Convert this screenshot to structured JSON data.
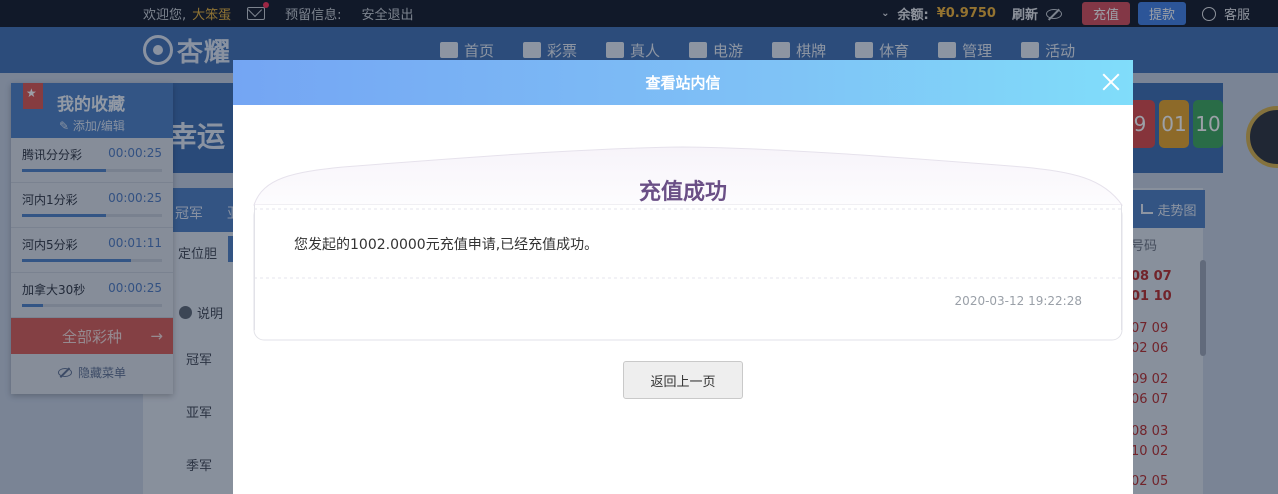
{
  "topbar": {
    "welcome": "欢迎您,",
    "username": "大笨蛋",
    "presale": "预留信息:",
    "logout": "安全退出",
    "balance_label": "余额:",
    "balance_value": "¥0.9750",
    "refresh": "刷新",
    "recharge": "充值",
    "withdraw": "提款",
    "service": "客服"
  },
  "nav": {
    "logo": "杏耀",
    "items": [
      "首页",
      "彩票",
      "真人",
      "电游",
      "棋牌",
      "体育",
      "管理",
      "活动"
    ]
  },
  "background": {
    "banner_text": "幸运",
    "balls": [
      "9",
      "01",
      "10"
    ],
    "tabs": [
      "冠军",
      "亚"
    ],
    "sub_label": "定位胆",
    "explain": "说明",
    "ranks": [
      "冠军",
      "亚军",
      "季军"
    ],
    "trend": "走势图",
    "haoma": "号码",
    "numbers": [
      [
        "08 07",
        "01 10"
      ],
      [
        "07 09",
        "02 06"
      ],
      [
        "09 02",
        "06 07"
      ],
      [
        "08 03",
        "10 02"
      ],
      [
        "02 05"
      ]
    ],
    "ball_colors": [
      "#d94646",
      "#e6a227",
      "#3aa65a"
    ]
  },
  "favorites": {
    "title": "我的收藏",
    "edit": "添加/编辑",
    "items": [
      {
        "name": "腾讯分分彩",
        "time": "00:00:25",
        "progress": 0.6
      },
      {
        "name": "河内1分彩",
        "time": "00:00:25",
        "progress": 0.6
      },
      {
        "name": "河内5分彩",
        "time": "00:01:11",
        "progress": 0.78
      },
      {
        "name": "加拿大30秒",
        "time": "00:00:25",
        "progress": 0.15
      }
    ],
    "all": "全部彩种",
    "hide": "隐藏菜单"
  },
  "modal": {
    "title": "查看站内信",
    "message_title": "充值成功",
    "message_body": "您发起的1002.0000元充值申请,已经充值成功。",
    "message_time": "2020-03-12 19:22:28",
    "back_button": "返回上一页"
  }
}
